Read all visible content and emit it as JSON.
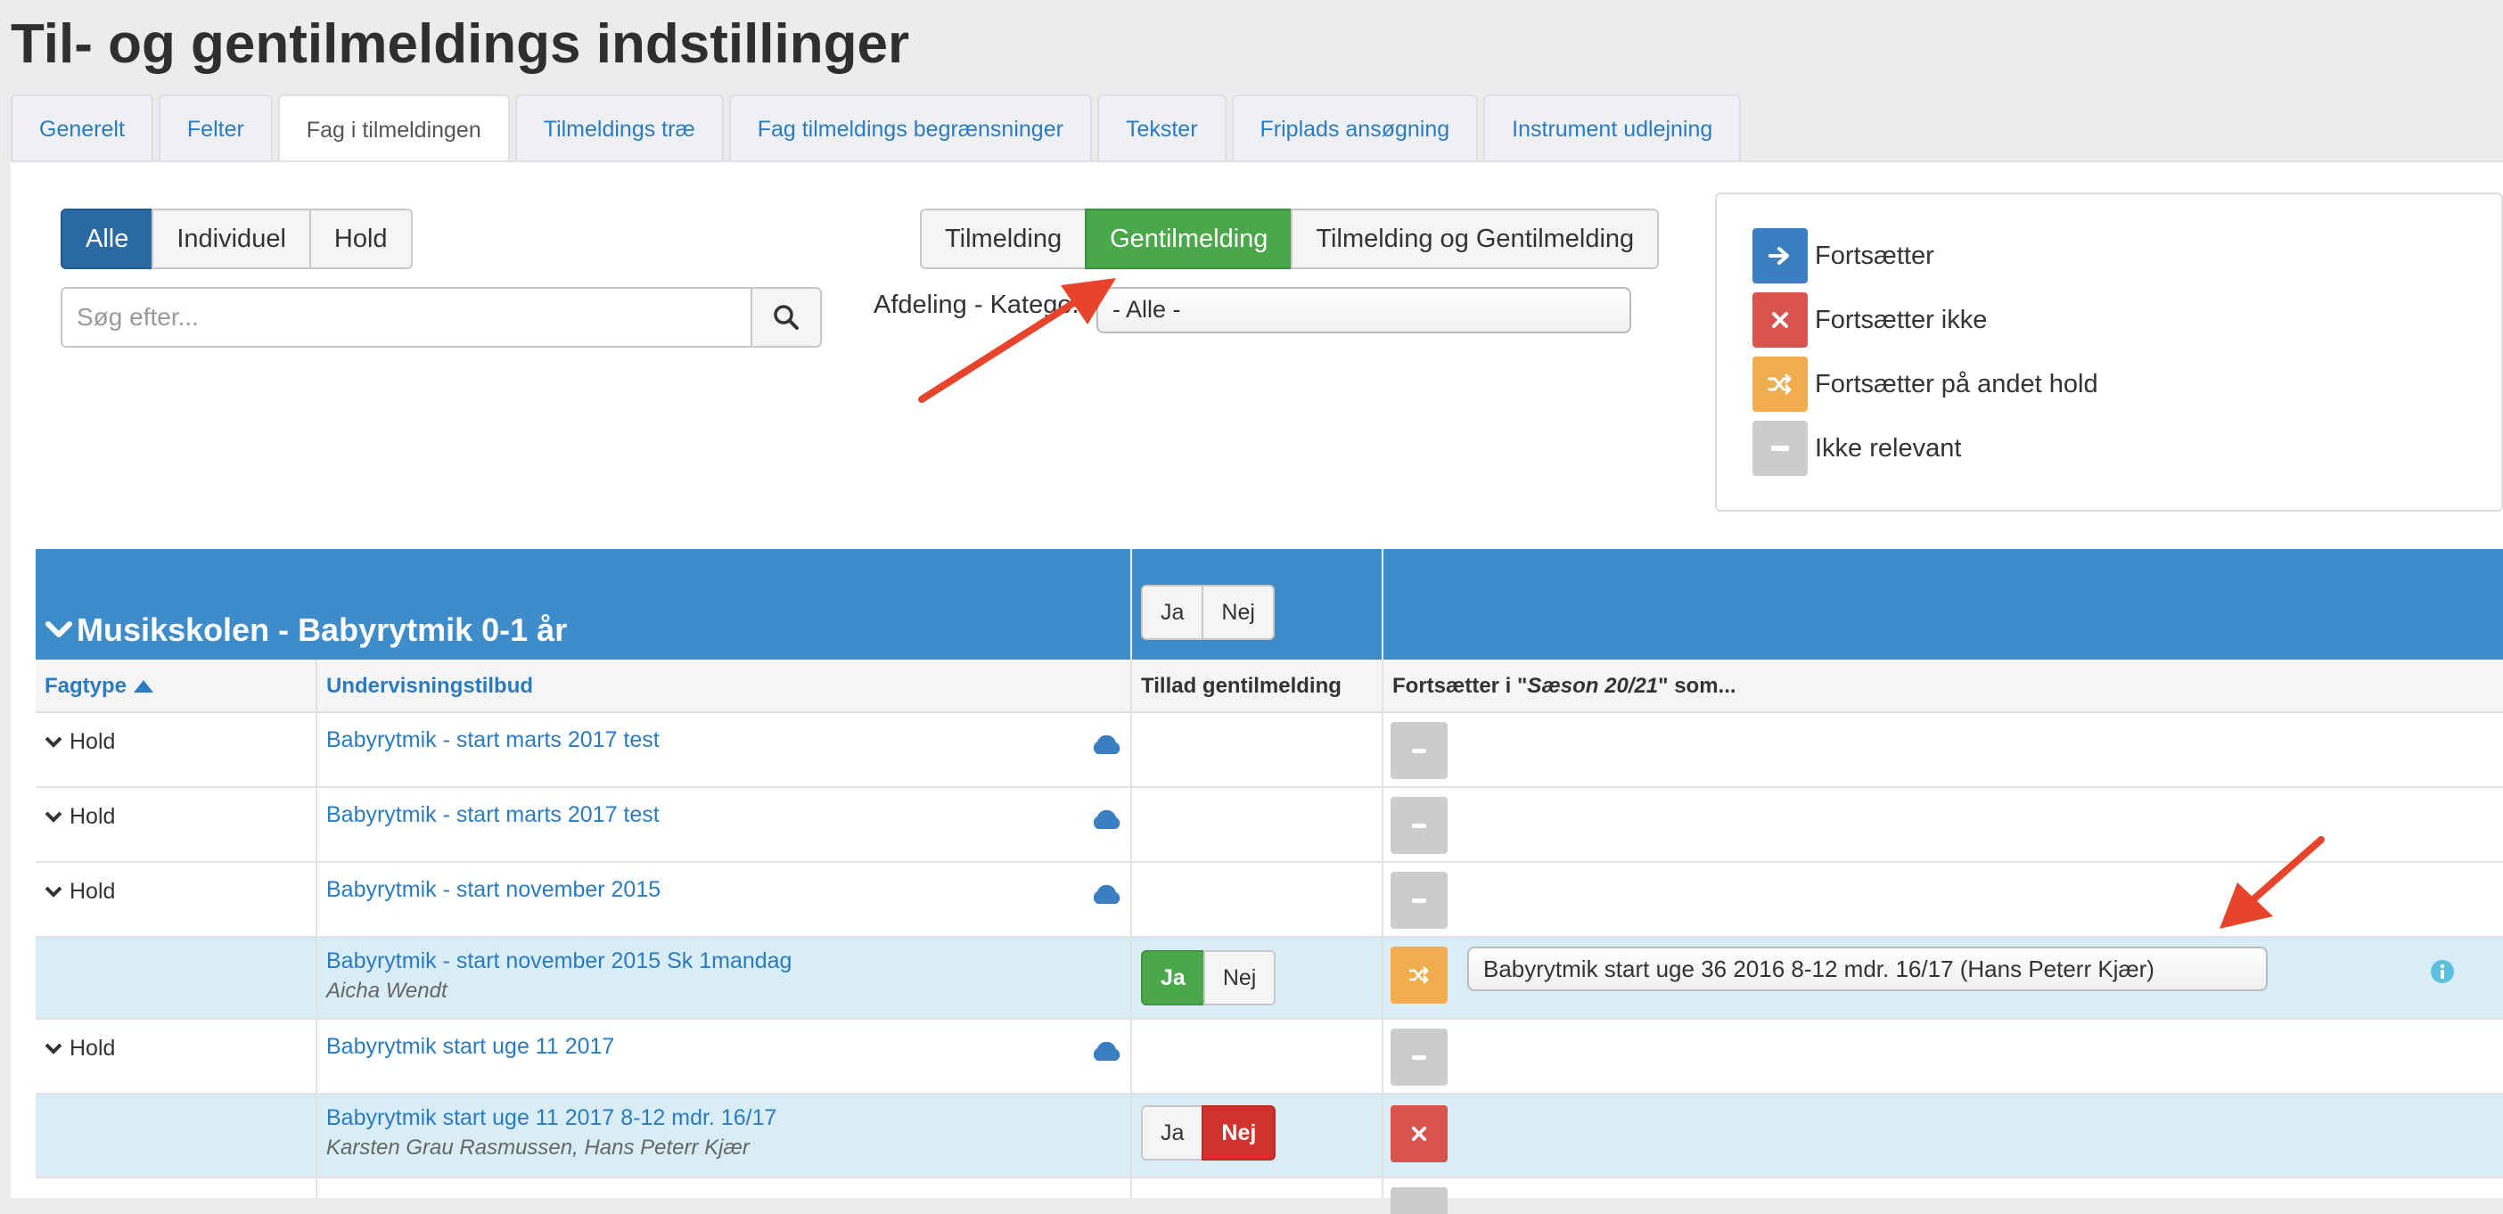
{
  "page_title": "Til- og gentilmeldings indstillinger",
  "tabs": [
    {
      "label": "Generelt",
      "active": false
    },
    {
      "label": "Felter",
      "active": false
    },
    {
      "label": "Fag i tilmeldingen",
      "active": true
    },
    {
      "label": "Tilmeldings træ",
      "active": false
    },
    {
      "label": "Fag tilmeldings begrænsninger",
      "active": false
    },
    {
      "label": "Tekster",
      "active": false
    },
    {
      "label": "Friplads ansøgning",
      "active": false
    },
    {
      "label": "Instrument udlejning",
      "active": false
    }
  ],
  "filter": {
    "type_buttons": [
      "Alle",
      "Individuel",
      "Hold"
    ],
    "mode_buttons": [
      "Tilmelding",
      "Gentilmelding",
      "Tilmelding og Gentilmelding"
    ],
    "search_placeholder": "Søg efter...",
    "department_label": "Afdeling - Katego...",
    "department_value": "- Alle -"
  },
  "legend": {
    "items": [
      {
        "label": "Fortsætter",
        "color": "#3a7fc1",
        "icon": "arrow-right-icon"
      },
      {
        "label": "Fortsætter ikke",
        "color": "#d9534f",
        "icon": "close-icon"
      },
      {
        "label": "Fortsætter på andet hold",
        "color": "#f0ad4e",
        "icon": "shuffle-icon"
      },
      {
        "label": "Ikke relevant",
        "color": "#cccccc",
        "icon": "minus-icon"
      }
    ]
  },
  "table": {
    "group_title": "Musikskolen - Babyrytmik 0-1 år",
    "group_ja": "Ja",
    "group_nej": "Nej",
    "headers": {
      "fagtype": "Fagtype",
      "undervisningstilbud": "Undervisningstilbud",
      "tillad": "Tillad gentilmelding",
      "fortsaetter_prefix": "Fortsætter i \"",
      "fortsaetter_season": "Sæson 20/21",
      "fortsaetter_suffix": "\" som..."
    },
    "rows": [
      {
        "type": "Hold",
        "title": "Babyrytmik - start marts 2017 test"
      },
      {
        "type": "Hold",
        "title": "Babyrytmik - start marts 2017 test"
      },
      {
        "type": "Hold",
        "title": "Babyrytmik - start november 2015"
      },
      {
        "title": "Babyrytmik - start november 2015 Sk 1mandag",
        "teacher": "Aicha Wendt",
        "ja": "Ja",
        "nej": "Nej",
        "selected": "Ja",
        "continue_value": "Babyrytmik start uge 36 2016 8-12 mdr. 16/17 (Hans Peterr Kjær)"
      },
      {
        "type": "Hold",
        "title": "Babyrytmik start uge 11 2017"
      },
      {
        "title": "Babyrytmik start uge 11 2017 8-12 mdr. 16/17",
        "teacher": "Karsten Grau Rasmussen, Hans Peterr Kjær",
        "ja": "Ja",
        "nej": "Nej",
        "selected": "Nej"
      }
    ]
  }
}
